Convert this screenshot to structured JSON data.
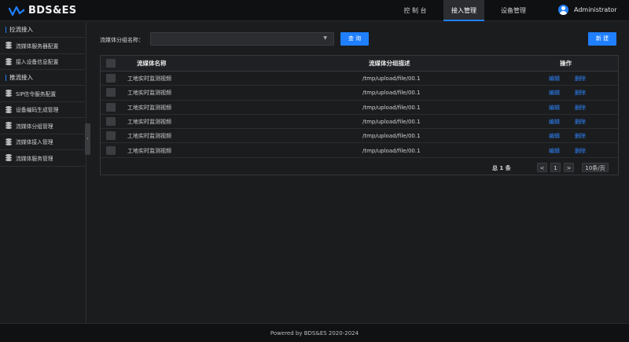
{
  "app": {
    "logo_text": "BDS&ES"
  },
  "nav": {
    "items": [
      {
        "label": "控 制 台"
      },
      {
        "label": "接入管理"
      },
      {
        "label": "设备管理"
      }
    ],
    "active_index": 1
  },
  "user": {
    "name": "Administrator"
  },
  "sidebar": {
    "groups": [
      {
        "label": "拉流接入",
        "items": [
          "流媒体服务器配置",
          "接入设备信息配置"
        ]
      },
      {
        "label": "推流接入",
        "items": [
          "SIP信令服务配置",
          "设备编码生成管理",
          "流媒体分组管理",
          "流媒体接入管理",
          "流媒体服务管理"
        ]
      }
    ],
    "collapse_glyph": "‹"
  },
  "search": {
    "label": "流媒体分组名称：",
    "select_value": "",
    "select_arrow": "▼",
    "query_button": "查 询",
    "new_button": "新 建"
  },
  "table": {
    "columns": [
      "流媒体名称",
      "流媒体分组描述",
      "操作"
    ],
    "rows": [
      {
        "name": "工地实时监测视频",
        "desc": "/tmp/upload/file/00.1",
        "edit": "编辑",
        "delete": "删除"
      },
      {
        "name": "工地实时监测视频",
        "desc": "/tmp/upload/file/00.1",
        "edit": "编辑",
        "delete": "删除"
      },
      {
        "name": "工地实时监测视频",
        "desc": "/tmp/upload/file/00.1",
        "edit": "编辑",
        "delete": "删除"
      },
      {
        "name": "工地实时监测视频",
        "desc": "/tmp/upload/file/00.1",
        "edit": "编辑",
        "delete": "删除"
      },
      {
        "name": "工地实时监测视频",
        "desc": "/tmp/upload/file/00.1",
        "edit": "编辑",
        "delete": "删除"
      },
      {
        "name": "工地实时监测视频",
        "desc": "/tmp/upload/file/00.1",
        "edit": "编辑",
        "delete": "删除"
      }
    ]
  },
  "pagination": {
    "total": "总 1 条",
    "prev": "<",
    "page": "1",
    "next": ">",
    "page_size": "10条/页"
  },
  "footer": {
    "text": "Powered by BDS&ES 2020-2024"
  },
  "colors": {
    "accent": "#1f7fff",
    "link": "#2d86ff",
    "background": "#1b1c1e",
    "header": "#0f1012"
  }
}
